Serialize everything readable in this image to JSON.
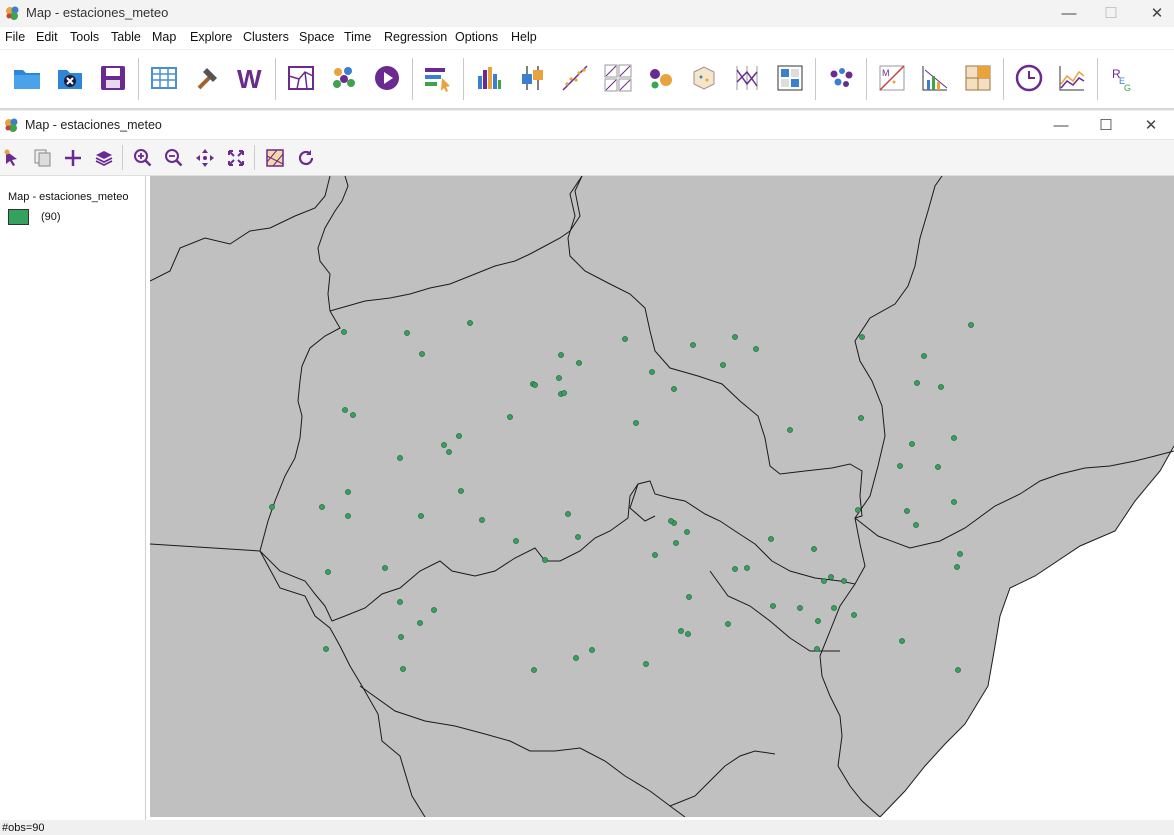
{
  "app": {
    "title": "Map - estaciones_meteo"
  },
  "window_controls": {
    "minimize": "—",
    "maximize": "☐",
    "close": "✕"
  },
  "menu": [
    "File",
    "Edit",
    "Tools",
    "Table",
    "Map",
    "Explore",
    "Clusters",
    "Space",
    "Time",
    "Regression",
    "Options",
    "Help"
  ],
  "toolbar_icons": [
    "open-folder-icon",
    "close-project-icon",
    "save-icon",
    "table-icon",
    "tools-hammer-icon",
    "weights-w-icon",
    "map-icon",
    "cluster-map-icon",
    "play-icon",
    "category-editor-icon",
    "histogram-icon",
    "box-plot-icon",
    "scatter-plot-icon",
    "scatter-matrix-icon",
    "bubble-chart-icon",
    "cube-3d-icon",
    "parallel-coordinates-icon",
    "conditional-map-icon",
    "cartogram-icon",
    "lisa-moran-icon",
    "local-g-icon",
    "spatial-lag-icon",
    "time-editor-icon",
    "averages-chart-icon",
    "regression-icon"
  ],
  "map_window": {
    "title": "Map - estaciones_meteo",
    "controls": {
      "minimize": "—",
      "maximize": "☐",
      "close": "✕"
    },
    "toolbar_icons": [
      "select-pointer-icon",
      "copy-layer-icon",
      "add-layer-icon",
      "layers-icon",
      "zoom-in-icon",
      "zoom-out-icon",
      "pan-icon",
      "full-extent-icon",
      "basemap-icon",
      "refresh-icon"
    ]
  },
  "legend": {
    "title": "Map - estaciones_meteo",
    "categories": [
      {
        "label": "(90)",
        "color": "#34a25c"
      }
    ]
  },
  "map": {
    "background_color": "#c0c0c0",
    "sea_color": "#ffffff",
    "point_color": "#34a25c",
    "point_count": 90
  },
  "status": {
    "text": "#obs=90"
  }
}
